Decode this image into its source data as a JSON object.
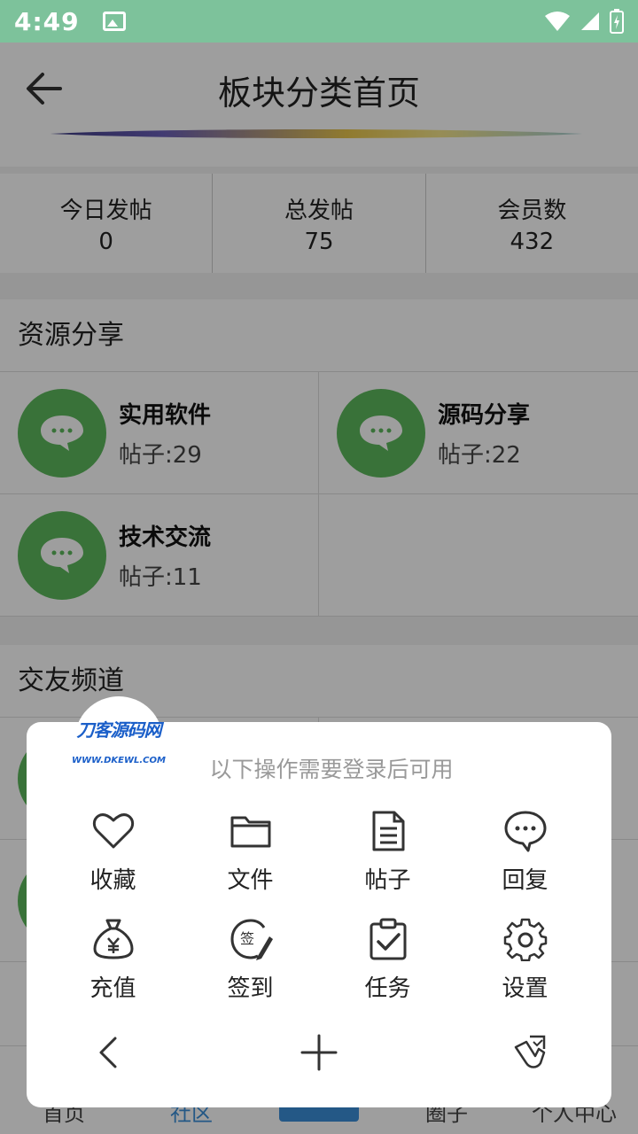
{
  "status_bar": {
    "time": "4:49"
  },
  "header": {
    "title": "板块分类首页"
  },
  "stats": [
    {
      "label": "今日发帖",
      "value": "0"
    },
    {
      "label": "总发帖",
      "value": "75"
    },
    {
      "label": "会员数",
      "value": "432"
    }
  ],
  "sections": [
    {
      "title": "资源分享",
      "boards": [
        {
          "name": "实用软件",
          "count": "帖子:29"
        },
        {
          "name": "源码分享",
          "count": "帖子:22"
        },
        {
          "name": "技术交流",
          "count": "帖子:11"
        }
      ]
    },
    {
      "title": "交友频道"
    }
  ],
  "bottom_nav": {
    "items": [
      "首页",
      "社区",
      "圈子",
      "个人中心"
    ]
  },
  "sheet": {
    "logo_text": "刀客源码网",
    "logo_url": "WWW.DKEWL.COM",
    "notice": "以下操作需要登录后可用",
    "actions": [
      {
        "label": "收藏",
        "icon": "heart-icon"
      },
      {
        "label": "文件",
        "icon": "folder-icon"
      },
      {
        "label": "帖子",
        "icon": "document-icon"
      },
      {
        "label": "回复",
        "icon": "chat-bubble-icon"
      },
      {
        "label": "充值",
        "icon": "money-bag-icon"
      },
      {
        "label": "签到",
        "icon": "sign-in-icon"
      },
      {
        "label": "任务",
        "icon": "clipboard-check-icon"
      },
      {
        "label": "设置",
        "icon": "gear-icon"
      }
    ]
  },
  "colors": {
    "status_bar": "#7dc29b",
    "board_icon": "#5cb85c",
    "accent": "#3a8fd8"
  }
}
